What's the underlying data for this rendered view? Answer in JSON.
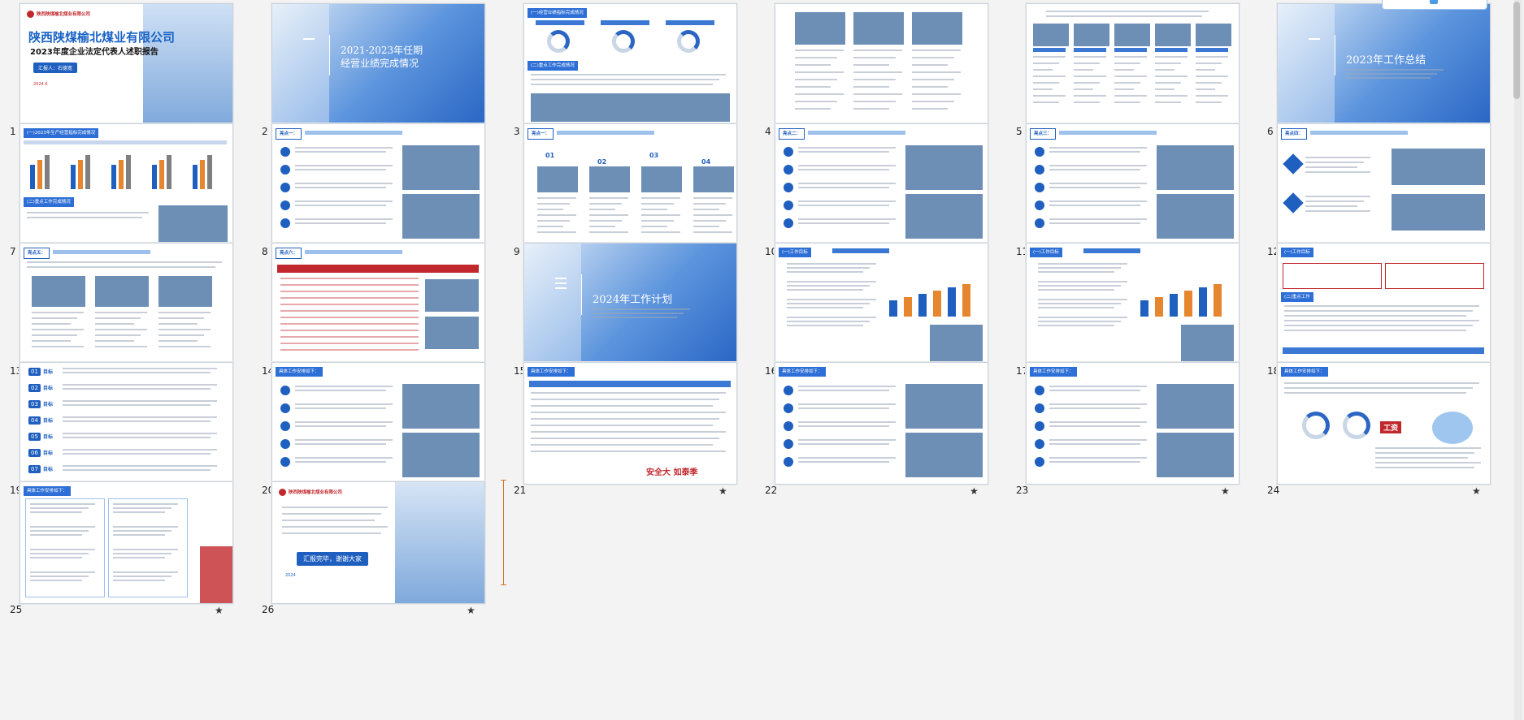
{
  "colors": {
    "accent": "#1f5fbf",
    "title_blue": "#1a63c6",
    "red": "#c0282d",
    "bg": "#f3f3f3"
  },
  "slides": [
    {
      "number": "1",
      "company_logo": "陕西陕煤榆北煤业有限公司",
      "title": "陕西陕煤榆北煤业有限公司",
      "subtitle": "2023年度企业法定代表人述职报告",
      "reporter": "汇报人：石德宽",
      "date": "2024.6"
    },
    {
      "number": "2",
      "title_line1": "2021-2023年任期",
      "title_line2": "经营业绩完成情况"
    },
    {
      "number": "3",
      "heading": "(一)经营业绩指标完成情况",
      "section": "(二)重点工作完成情况"
    },
    {
      "number": "4"
    },
    {
      "number": "5"
    },
    {
      "number": "6",
      "title": "2023年工作总结"
    },
    {
      "number": "7",
      "heading": "(一)2023年生产经营指标完成情况",
      "section": "(二)重点工作完成情况"
    },
    {
      "number": "8",
      "label": "亮点一："
    },
    {
      "number": "9",
      "label": "亮点一：",
      "items": [
        "01",
        "02",
        "03",
        "04"
      ]
    },
    {
      "number": "10",
      "label": "亮点二："
    },
    {
      "number": "11",
      "label": "亮点三："
    },
    {
      "number": "12",
      "label": "亮点四："
    },
    {
      "number": "13",
      "label": "亮点五："
    },
    {
      "number": "14",
      "label": "亮点六："
    },
    {
      "number": "15",
      "title": "2024年工作计划"
    },
    {
      "number": "16",
      "heading": "(一)工作目标"
    },
    {
      "number": "17",
      "heading": "(一)工作目标"
    },
    {
      "number": "18",
      "heading": "(一)工作目标",
      "section": "(二)重点工作"
    },
    {
      "number": "19",
      "items": [
        "01",
        "02",
        "03",
        "04",
        "05",
        "06",
        "07"
      ],
      "item_label": "目标"
    },
    {
      "number": "20",
      "heading": "具体工作安排如下："
    },
    {
      "number": "21",
      "heading": "具体工作安排如下：",
      "slogan": "安全大 如泰季"
    },
    {
      "number": "22",
      "heading": "具体工作安排如下："
    },
    {
      "number": "23",
      "heading": "具体工作安排如下："
    },
    {
      "number": "24",
      "heading": "具体工作安排如下：",
      "stamp": "工资"
    },
    {
      "number": "25",
      "heading": "具体工作安排如下："
    },
    {
      "number": "26",
      "company_logo": "陕西陕煤榆北煤业有限公司",
      "closing": "汇报完毕，谢谢大家",
      "date": "2024"
    }
  ],
  "star_glyph": "★"
}
